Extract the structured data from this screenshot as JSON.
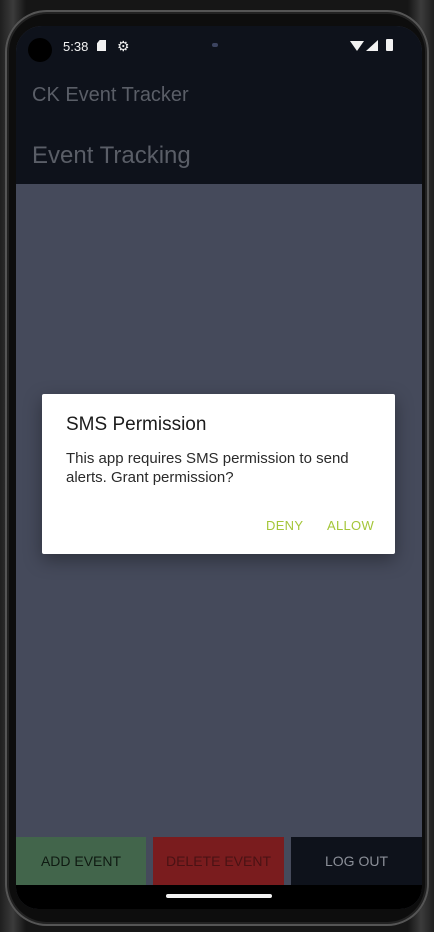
{
  "status_bar": {
    "time": "5:38",
    "icons": [
      "sd-card-icon",
      "gear-icon",
      "wifi-icon",
      "signal-icon",
      "battery-icon"
    ]
  },
  "header": {
    "app_title": "CK Event Tracker",
    "page_title": "Event Tracking"
  },
  "dialog": {
    "title": "SMS Permission",
    "message": "This app requires SMS permission to send alerts. Grant permission?",
    "deny_label": "DENY",
    "allow_label": "ALLOW"
  },
  "bottom_bar": {
    "add_label": "ADD EVENT",
    "delete_label": "DELETE EVENT",
    "logout_label": "LOG OUT"
  },
  "colors": {
    "header_bg": "#0e121b",
    "scrim": "#454a5b",
    "dialog_button": "#a4c639",
    "add_button": "#42654b",
    "delete_button": "#7a1c1e"
  }
}
